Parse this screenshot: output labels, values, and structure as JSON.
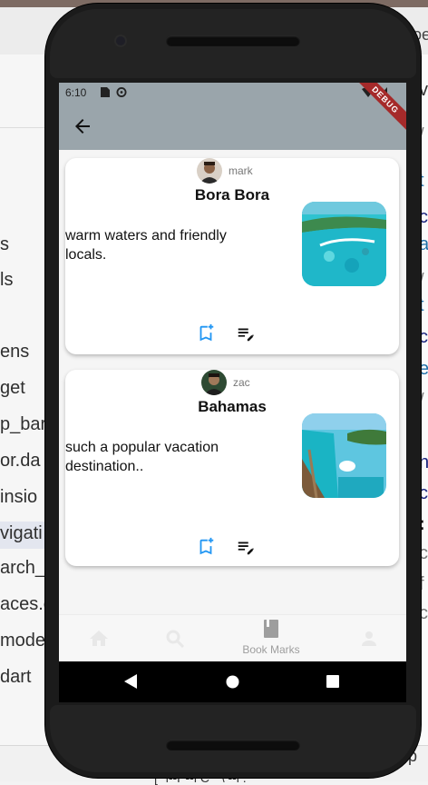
{
  "ide": {
    "tab_label": "oe",
    "files": [
      "s",
      "ls",
      "ens",
      "get",
      "p_bar",
      "or.da",
      "insio",
      "vigati",
      "arch_r",
      "aces.c",
      "mode",
      "dart"
    ],
    "code_chars": [
      "vi",
      "/",
      "t",
      "c",
      "a",
      "/",
      "t",
      "c",
      "e",
      "/",
      "n",
      "c",
      ":",
      "c",
      "f",
      "c"
    ],
    "status_text": "[\"  l--P--l C   \" \\ --l   .",
    "status_right": "op"
  },
  "status": {
    "time": "6:10"
  },
  "debug_label": "DEBUG",
  "colors": {
    "appbar": "#9aa5ab",
    "accent": "#2196f3",
    "debug": "#a52a2a"
  },
  "posts": [
    {
      "author": "mark",
      "title": "Bora Bora",
      "description": "warm waters and friendly locals.",
      "image_icon": "bora-bora-photo",
      "actions": [
        "bookmark-add-icon",
        "playlist-edit-icon"
      ]
    },
    {
      "author": "zac",
      "title": "Bahamas",
      "description": " such a popular vacation destination..",
      "image_icon": "bahamas-photo",
      "actions": [
        "bookmark-add-icon",
        "playlist-edit-icon"
      ]
    }
  ],
  "nav": {
    "items": [
      "home-icon",
      "search-icon",
      "book-icon",
      "person-icon"
    ],
    "selected_label": "Book Marks"
  },
  "system_nav": [
    "back-triangle-icon",
    "home-circle-icon",
    "recents-square-icon"
  ]
}
